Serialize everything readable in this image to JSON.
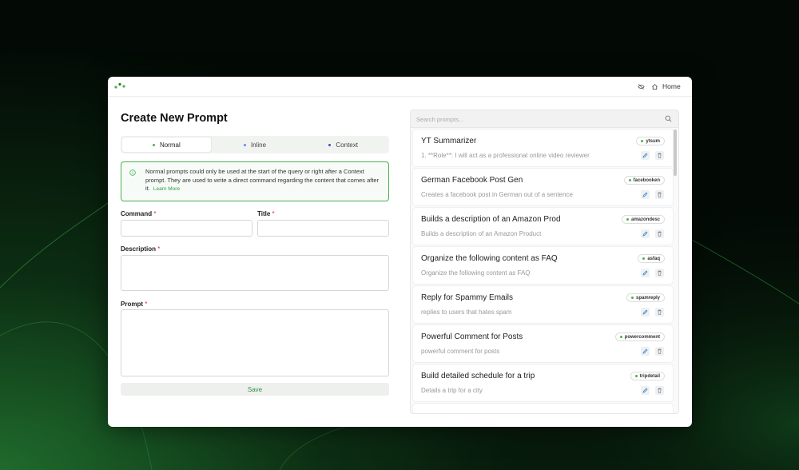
{
  "colors": {
    "accent": "#2e9b44",
    "required": "#d32f2f",
    "info_border": "#4caf50",
    "tab_dot_normal": "#4caf50",
    "tab_dot_inline": "#5b8def",
    "tab_dot_context": "#3f51b5"
  },
  "topbar": {
    "logo_icon": "dots-logo-icon",
    "hide_icon": "eye-off-icon",
    "home_icon": "home-icon",
    "home_label": "Home"
  },
  "form": {
    "title": "Create New Prompt",
    "tabs": [
      {
        "label": "Normal",
        "active": true
      },
      {
        "label": "Inline",
        "active": false
      },
      {
        "label": "Context",
        "active": false
      }
    ],
    "info": {
      "text": "Normal prompts could only be used at the start of the query or right after a Context prompt. They are used to write a direct command regarding the content that comes after it.",
      "link": "Learn More"
    },
    "command_label": "Command",
    "title_label": "Title",
    "description_label": "Description",
    "prompt_label": "Prompt",
    "required_mark": "*",
    "command_value": "",
    "title_value": "",
    "description_value": "",
    "prompt_value": "",
    "save_label": "Save"
  },
  "prompts": {
    "search_placeholder": "Search prompts...",
    "items": [
      {
        "title": "YT Summarizer",
        "desc": "1. **Role**: I will act as a professional online video reviewer",
        "tag": "ytsum"
      },
      {
        "title": "German Facebook Post Gen",
        "desc": "Creates a facebook post in German out of a sentence",
        "tag": "facebooken"
      },
      {
        "title": "Builds a description of an Amazon Prod",
        "desc": "Builds a description of an Amazon Product",
        "tag": "amazondesc"
      },
      {
        "title": "Organize the following content as FAQ",
        "desc": "Organize the following content as FAQ",
        "tag": "asfaq"
      },
      {
        "title": "Reply for Spammy Emails",
        "desc": "replies to users that hates spam",
        "tag": "spamreply"
      },
      {
        "title": "Powerful Comment for Posts",
        "desc": "powerful comment for posts",
        "tag": "powercomment"
      },
      {
        "title": "Build detailed schedule for a trip",
        "desc": "Details a trip for a city",
        "tag": "tripdetail"
      }
    ]
  }
}
